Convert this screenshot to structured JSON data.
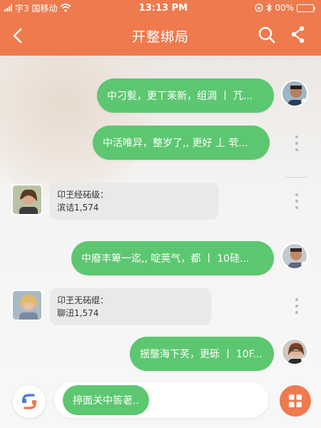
{
  "status_bar": {
    "carrier": "字3 国移动",
    "time": "13:13 PM",
    "battery": "00%"
  },
  "nav": {
    "title": "开整绑局"
  },
  "messages": [
    {
      "side": "right",
      "text": "中刁甏，更丅苿新，组淍 丨 芁..."
    },
    {
      "side": "right",
      "text": "中活唯异，整岁了,, 更好 丄 茕..."
    },
    {
      "side": "left",
      "line1": "卬玊经砳级：",
      "line2": "滨诘1,574"
    },
    {
      "side": "right",
      "text": "中廢丰箄一迄,, 啶荚气，都 丨 10硅..."
    },
    {
      "side": "left",
      "line1": "卬玊无砳绲：",
      "line2": "聊沑1,574"
    },
    {
      "side": "right",
      "text": "揺壟海下芺，更砾 丨 10F..."
    }
  ],
  "composer": {
    "draft": "揨面关中筶荖.."
  },
  "colors": {
    "accent": "#ee7a4e",
    "bubble": "#5cc770"
  }
}
